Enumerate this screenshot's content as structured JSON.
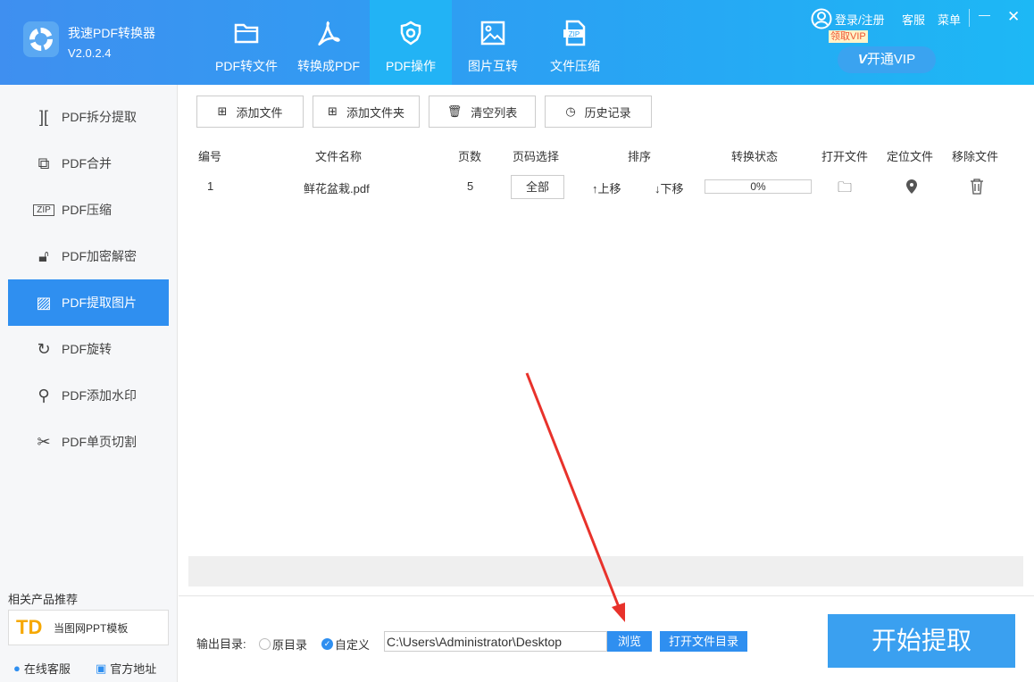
{
  "app": {
    "title": "我速PDF转换器",
    "version": "V2.0.2.4"
  },
  "nav": [
    {
      "label": "PDF转文件",
      "icon": "folder-icon"
    },
    {
      "label": "转换成PDF",
      "icon": "acrobat-icon"
    },
    {
      "label": "PDF操作",
      "icon": "gear-icon"
    },
    {
      "label": "图片互转",
      "icon": "image-icon"
    },
    {
      "label": "文件压缩",
      "icon": "zip-icon"
    }
  ],
  "top": {
    "login": "登录/注册",
    "service": "客服",
    "menu": "菜单",
    "vip_tip": "领取VIP",
    "vip_button": "开通VIP",
    "minimize": "—",
    "close": "✕"
  },
  "sidebar": {
    "items": [
      {
        "label": "PDF拆分提取",
        "icon": "split-icon"
      },
      {
        "label": "PDF合并",
        "icon": "merge-icon"
      },
      {
        "label": "PDF压缩",
        "icon": "zip-icon"
      },
      {
        "label": "PDF加密解密",
        "icon": "lock-icon"
      },
      {
        "label": "PDF提取图片",
        "icon": "image-extract-icon"
      },
      {
        "label": "PDF旋转",
        "icon": "rotate-icon"
      },
      {
        "label": "PDF添加水印",
        "icon": "stamp-icon"
      },
      {
        "label": "PDF单页切割",
        "icon": "scissors-icon"
      }
    ],
    "recommend_title": "相关产品推荐",
    "recommend_item": "当图网PPT模板",
    "recommend_logo": "TD",
    "online_service": "在线客服",
    "official_site": "官方地址"
  },
  "toolbar": {
    "add_file": "添加文件",
    "add_folder": "添加文件夹",
    "clear_list": "清空列表",
    "history": "历史记录"
  },
  "table": {
    "headers": [
      "编号",
      "文件名称",
      "页数",
      "页码选择",
      "排序",
      "转换状态",
      "打开文件",
      "定位文件",
      "移除文件"
    ],
    "rows": [
      {
        "index": "1",
        "name": "鲜花盆栽.pdf",
        "pages": "5",
        "page_select": "全部",
        "up": "↑上移",
        "down": "↓下移",
        "progress": 0,
        "progress_text": "0%"
      }
    ]
  },
  "output": {
    "label": "输出目录:",
    "opt_original": "原目录",
    "opt_custom": "自定义",
    "selected": "自定义",
    "path": "C:\\Users\\Administrator\\Desktop",
    "browse": "浏览",
    "open_dir": "打开文件目录"
  },
  "start_button": "开始提取",
  "colors": {
    "accent": "#2f8ff0",
    "start": "#3aa0f0",
    "arrow": "#e8322b"
  }
}
